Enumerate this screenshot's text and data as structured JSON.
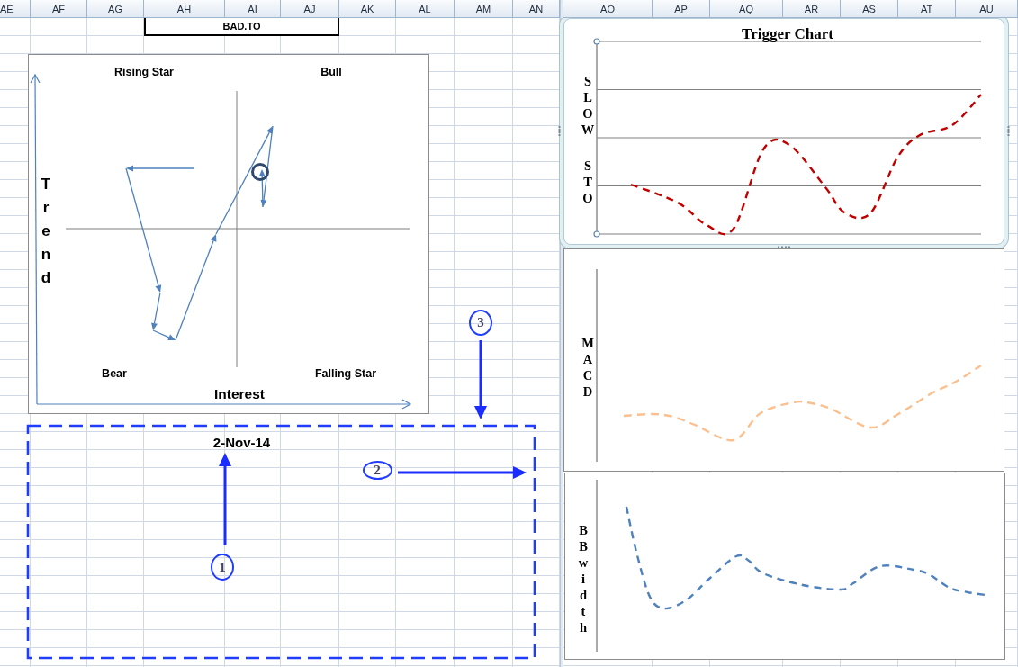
{
  "column_headers": {
    "left": [
      "AE",
      "AF",
      "AG",
      "AH",
      "AI",
      "AJ",
      "AK",
      "AL",
      "AM",
      "AN"
    ],
    "right": [
      "AO",
      "AP",
      "AQ",
      "AR",
      "AS",
      "AT",
      "AU"
    ]
  },
  "cells": [
    {
      "kind": "ticker",
      "text": "BAD.TO"
    },
    {
      "kind": "date",
      "text": "2-Nov-14"
    }
  ],
  "quadrant_chart": {
    "quadrant_labels": [
      "Rising Star",
      "Bull",
      "Bear",
      "Falling Star"
    ],
    "xlabel": "Interest",
    "ylabel": "Trend"
  },
  "callouts": [
    {
      "label": "1"
    },
    {
      "label": "2"
    },
    {
      "label": "3"
    }
  ],
  "charts": [
    {
      "title": "Trigger Chart",
      "ylabel": "SLOW STO",
      "selected": true,
      "gridlines": true,
      "color": "#c00000"
    },
    {
      "ylabel": "MACD",
      "selected": false,
      "gridlines": false,
      "color": "#fac090"
    },
    {
      "ylabel": "BBwidth",
      "selected": false,
      "gridlines": false,
      "color": "#4f81bd"
    }
  ]
}
